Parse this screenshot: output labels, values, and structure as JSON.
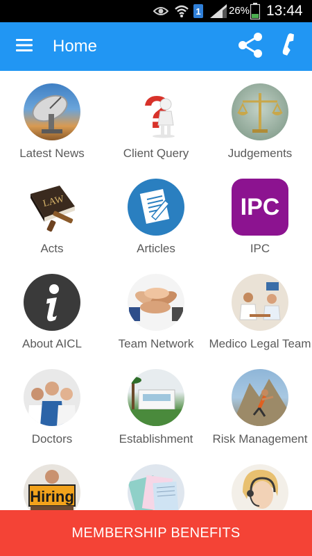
{
  "status_bar": {
    "battery_percent": "26%",
    "time": "13:44",
    "icons": [
      "eye-icon",
      "wifi-icon",
      "sim-1-icon",
      "signal-icon",
      "battery-icon"
    ]
  },
  "app_bar": {
    "title": "Home",
    "menu_icon": "hamburger-menu-icon",
    "share_icon": "share-icon",
    "call_icon": "phone-icon",
    "color": "#2196f3"
  },
  "grid": {
    "items": [
      {
        "label": "Latest News",
        "icon": "satellite-dish-icon"
      },
      {
        "label": "Client Query",
        "icon": "question-mark-person-icon"
      },
      {
        "label": "Judgements",
        "icon": "scales-of-justice-icon"
      },
      {
        "label": "Acts",
        "icon": "law-book-gavel-icon"
      },
      {
        "label": "Articles",
        "icon": "document-pen-icon"
      },
      {
        "label": "IPC",
        "icon": "ipc-icon"
      },
      {
        "label": "About AICL",
        "icon": "info-icon"
      },
      {
        "label": "Team Network",
        "icon": "team-hands-icon"
      },
      {
        "label": "Medico Legal Team",
        "icon": "medical-team-icon"
      },
      {
        "label": "Doctors",
        "icon": "doctors-icon"
      },
      {
        "label": "Establishment",
        "icon": "building-icon"
      },
      {
        "label": "Risk Management",
        "icon": "climber-icon"
      },
      {
        "label": "",
        "icon": "hiring-icon",
        "sign_text": "Hiring"
      },
      {
        "label": "",
        "icon": "notebooks-icon"
      },
      {
        "label": "",
        "icon": "support-agent-icon"
      }
    ]
  },
  "footer": {
    "membership_label": "MEMBERSHIP BENEFITS",
    "color": "#f44336"
  }
}
